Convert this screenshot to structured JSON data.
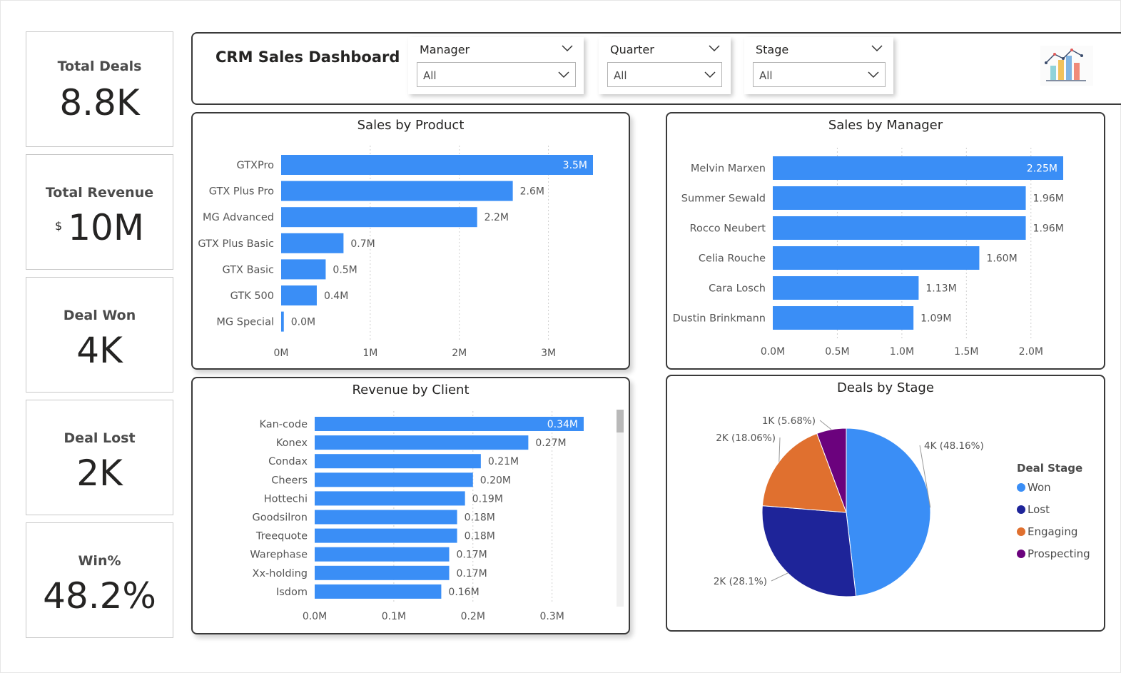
{
  "header": {
    "title": "CRM Sales Dashboard"
  },
  "kpis": [
    {
      "label": "Total Deals",
      "value": "8.8K"
    },
    {
      "label": "Total Revenue",
      "prefix": "$",
      "value": "10M"
    },
    {
      "label": "Deal Won",
      "value": "4K"
    },
    {
      "label": "Deal Lost",
      "value": "2K"
    },
    {
      "label": "Win%",
      "value": "48.2%"
    }
  ],
  "filters": [
    {
      "label": "Manager",
      "value": "All"
    },
    {
      "label": "Quarter",
      "value": "All"
    },
    {
      "label": "Stage",
      "value": "All"
    }
  ],
  "logo_icon": "chart-logo-icon",
  "colors": {
    "bar": "#3a8ef6",
    "won": "#3a8ef6",
    "lost": "#1e2499",
    "engaging": "#e0702f",
    "prospecting": "#6b027d"
  },
  "chart_data": [
    {
      "type": "bar",
      "title": "Sales by Product",
      "categories": [
        "GTXPro",
        "GTX Plus Pro",
        "MG Advanced",
        "GTX Plus Basic",
        "GTX Basic",
        "GTK 500",
        "MG Special"
      ],
      "values": [
        3.5,
        2.6,
        2.2,
        0.7,
        0.5,
        0.4,
        0.03
      ],
      "data_labels": [
        "3.5M",
        "2.6M",
        "2.2M",
        "0.7M",
        "0.5M",
        "0.4M",
        "0.0M"
      ],
      "xlim": [
        0,
        3.5
      ],
      "xticks": [
        0,
        1,
        2,
        3
      ],
      "xtick_labels": [
        "0M",
        "1M",
        "2M",
        "3M"
      ]
    },
    {
      "type": "bar",
      "title": "Sales by Manager",
      "categories": [
        "Melvin Marxen",
        "Summer Sewald",
        "Rocco Neubert",
        "Celia Rouche",
        "Cara Losch",
        "Dustin Brinkmann"
      ],
      "values": [
        2.25,
        1.96,
        1.96,
        1.6,
        1.13,
        1.09
      ],
      "data_labels": [
        "2.25M",
        "1.96M",
        "1.96M",
        "1.60M",
        "1.13M",
        "1.09M"
      ],
      "xlim": [
        0,
        2.25
      ],
      "xticks": [
        0,
        0.5,
        1.0,
        1.5,
        2.0
      ],
      "xtick_labels": [
        "0.0M",
        "0.5M",
        "1.0M",
        "1.5M",
        "2.0M"
      ]
    },
    {
      "type": "bar",
      "title": "Revenue by Client",
      "categories": [
        "Kan-code",
        "Konex",
        "Condax",
        "Cheers",
        "Hottechi",
        "Goodsilron",
        "Treequote",
        "Warephase",
        "Xx-holding",
        "Isdom"
      ],
      "values": [
        0.34,
        0.27,
        0.21,
        0.2,
        0.19,
        0.18,
        0.18,
        0.17,
        0.17,
        0.16
      ],
      "data_labels": [
        "0.34M",
        "0.27M",
        "0.21M",
        "0.20M",
        "0.19M",
        "0.18M",
        "0.18M",
        "0.17M",
        "0.17M",
        "0.16M"
      ],
      "xlim": [
        0,
        0.34
      ],
      "xticks": [
        0,
        0.1,
        0.2,
        0.3
      ],
      "xtick_labels": [
        "0.0M",
        "0.1M",
        "0.2M",
        "0.3M"
      ]
    },
    {
      "type": "pie",
      "title": "Deals by Stage",
      "legend_title": "Deal Stage",
      "legend_position": "right",
      "categories": [
        "Won",
        "Lost",
        "Engaging",
        "Prospecting"
      ],
      "values": [
        48.16,
        28.1,
        18.06,
        5.68
      ],
      "data_labels": [
        "4K (48.16%)",
        "2K (28.1%)",
        "2K (18.06%)",
        "1K (5.68%)"
      ]
    }
  ]
}
